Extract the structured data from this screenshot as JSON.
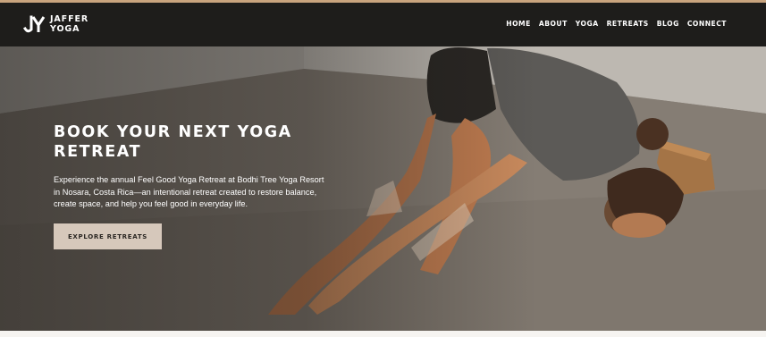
{
  "brand": {
    "logo_icon": "jy-monogram-logo",
    "name_line1": "JAFFER",
    "name_line2": "YOGA"
  },
  "nav": {
    "items": [
      {
        "label": "HOME"
      },
      {
        "label": "ABOUT"
      },
      {
        "label": "YOGA"
      },
      {
        "label": "RETREATS"
      },
      {
        "label": "BLOG"
      },
      {
        "label": "CONNECT"
      }
    ]
  },
  "hero": {
    "title": "BOOK YOUR NEXT YOGA RETREAT",
    "body": "Experience the annual Feel Good Yoga Retreat at Bodhi Tree Yoga Resort in Nosara, Costa Rica—an intentional retreat created to restore balance, create space, and help you feel good in everyday life.",
    "cta_label": "EXPLORE RETREATS"
  },
  "colors": {
    "header_bg": "#1e1d1b",
    "accent_line": "#c9a47e",
    "button_bg": "#d6c8bb",
    "button_text": "#2a2622"
  }
}
